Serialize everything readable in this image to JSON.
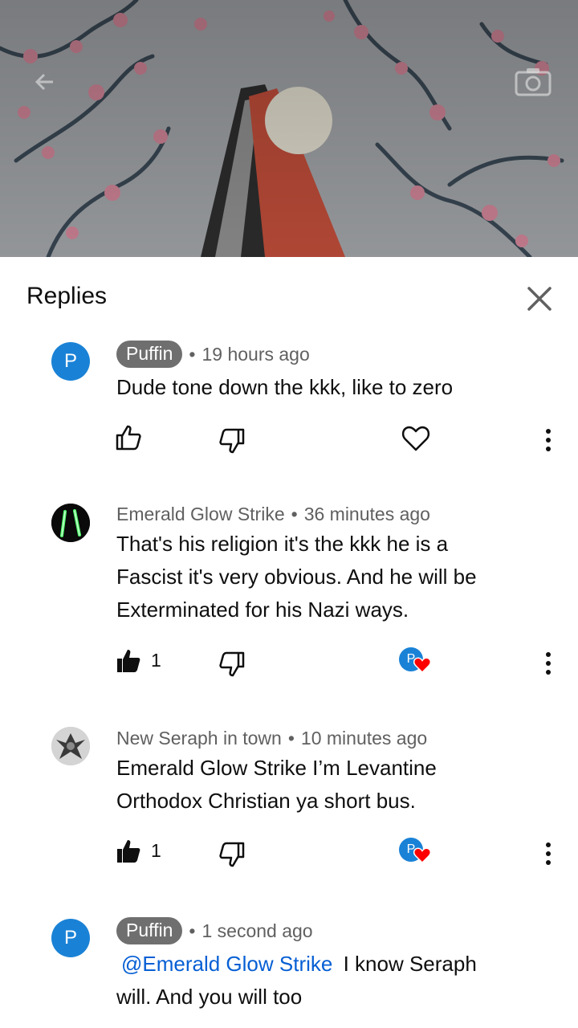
{
  "header": {
    "title": "Replies"
  },
  "replies": [
    {
      "author": "Puffin",
      "time": "19 hours ago",
      "avatar_letter": "P",
      "text": "Dude tone down the kkk, like to zero",
      "likes": ""
    },
    {
      "author": "Emerald Glow Strike",
      "time": "36 minutes ago",
      "text_lines": [
        "That's his religion it's the kkk he is a",
        "Fascist it's very obvious. And he will be",
        "Exterminated for his Nazi ways."
      ],
      "likes": "1",
      "heart_avatar_letter": "P"
    },
    {
      "author": "New Seraph in town",
      "time": "10 minutes ago",
      "text_lines": [
        "Emerald Glow Strike I’m Levantine",
        "Orthodox Christian ya short bus."
      ],
      "likes": "1",
      "heart_avatar_letter": "P"
    },
    {
      "author": "Puffin",
      "time": "1 second ago",
      "avatar_letter": "P",
      "mention": "@Emerald Glow Strike",
      "text_after_mention": "I know Seraph",
      "text_line2": "will. And you will too"
    }
  ],
  "colors": {
    "accent": "#065fd4",
    "avatar_blue": "#1a82d6",
    "heart_red": "#ff0000",
    "chip_gray": "#6f6f6f"
  },
  "icons": [
    "back-arrow-icon",
    "camera-icon",
    "close-icon",
    "thumbs-up-icon",
    "thumbs-down-icon",
    "heart-icon",
    "more-vert-icon"
  ]
}
